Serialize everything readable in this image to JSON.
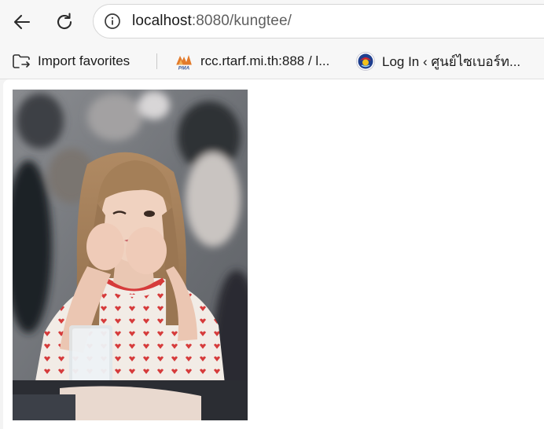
{
  "toolbar": {
    "url_host": "localhost",
    "url_rest": ":8080/kungtee/"
  },
  "favorites": {
    "items": [
      {
        "label": "Import favorites",
        "icon": "import-favorites-icon"
      },
      {
        "label": "rcc.rtarf.mi.th:888 / l...",
        "icon": "pma-icon"
      },
      {
        "label": "Log In ‹ ศูนย์ไซเบอร์ท...",
        "icon": "cyber-center-logo-icon"
      }
    ]
  },
  "colors": {
    "accent": "#e37b2b",
    "photo_background": "#6f7277",
    "shirt_pattern": "#d63b3b"
  }
}
